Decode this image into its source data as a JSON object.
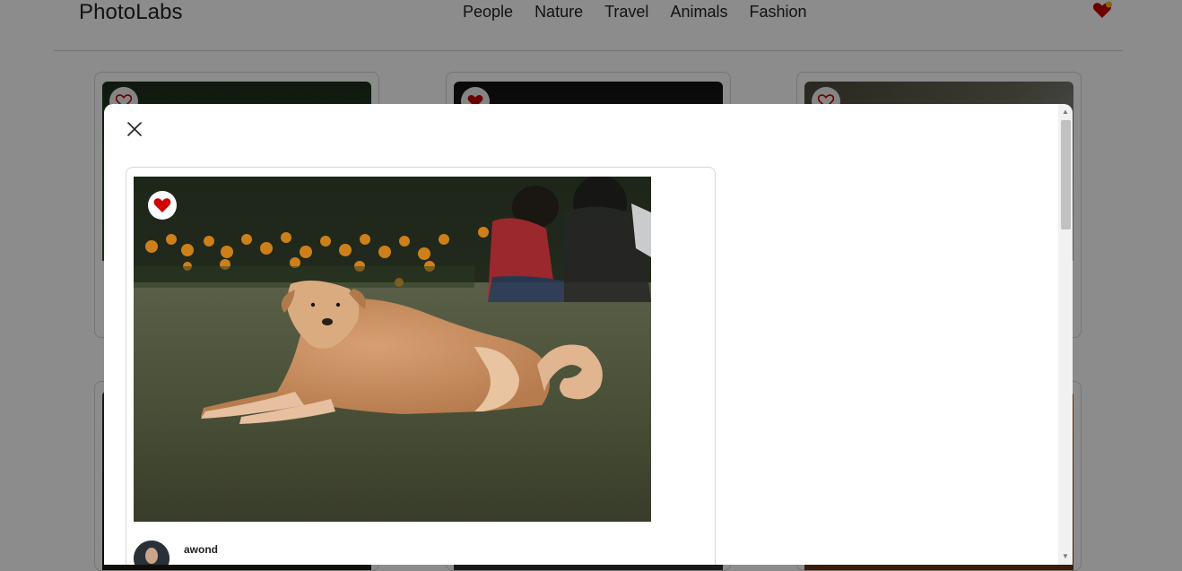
{
  "app": {
    "logo": "PhotoLabs"
  },
  "nav": {
    "topics": [
      "People",
      "Nature",
      "Travel",
      "Animals",
      "Fashion"
    ]
  },
  "modal": {
    "photo": {
      "favorited": true,
      "description": "tan dog lying on grass in front of orange flowers and seated people"
    },
    "user": {
      "username": "awond"
    }
  },
  "colors": {
    "accent_red": "#d30000",
    "overlay": "rgba(0,0,0,0.45)"
  },
  "icons": {
    "nav_favorites": "heart-with-notification-icon",
    "favorite": "heart-icon",
    "close": "close-icon"
  }
}
